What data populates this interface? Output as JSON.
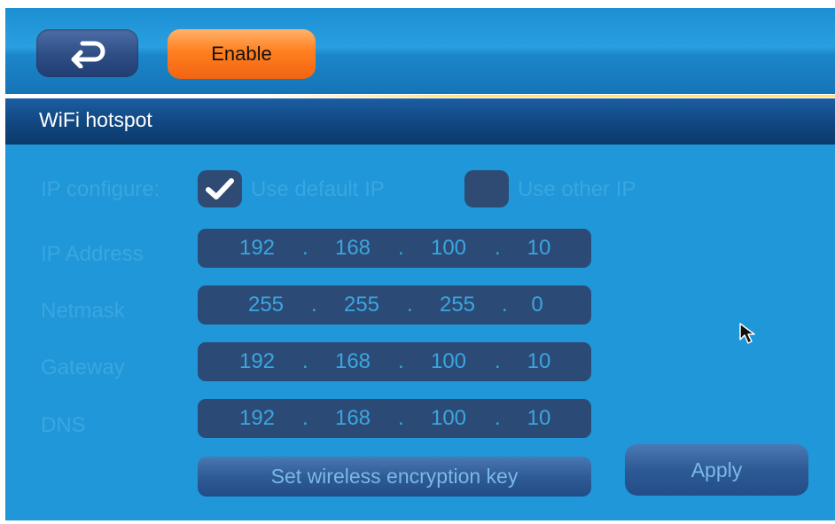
{
  "header": {
    "back_icon": "return-arrow-icon",
    "enable_label": "Enable"
  },
  "title": "WiFi hotspot",
  "form": {
    "ip_configure_label": "IP configure:",
    "use_default_ip": {
      "label": "Use default IP",
      "checked": true
    },
    "use_other_ip": {
      "label": "Use other IP",
      "checked": false
    },
    "ip_address": {
      "label": "IP Address",
      "octets": [
        "192",
        "168",
        "100",
        "10"
      ]
    },
    "netmask": {
      "label": "Netmask",
      "octets": [
        "255",
        "255",
        "255",
        "0"
      ]
    },
    "gateway": {
      "label": "Gateway",
      "octets": [
        "192",
        "168",
        "100",
        "10"
      ]
    },
    "dns": {
      "label": "DNS",
      "octets": [
        "192",
        "168",
        "100",
        "10"
      ]
    },
    "separator": "."
  },
  "actions": {
    "set_key_label": "Set wireless encryption key",
    "apply_label": "Apply"
  },
  "colors": {
    "background": "#1f97d8",
    "enable_button": "#ff7f1f",
    "title_bar": "#11467f",
    "field": "#2c4a76"
  }
}
